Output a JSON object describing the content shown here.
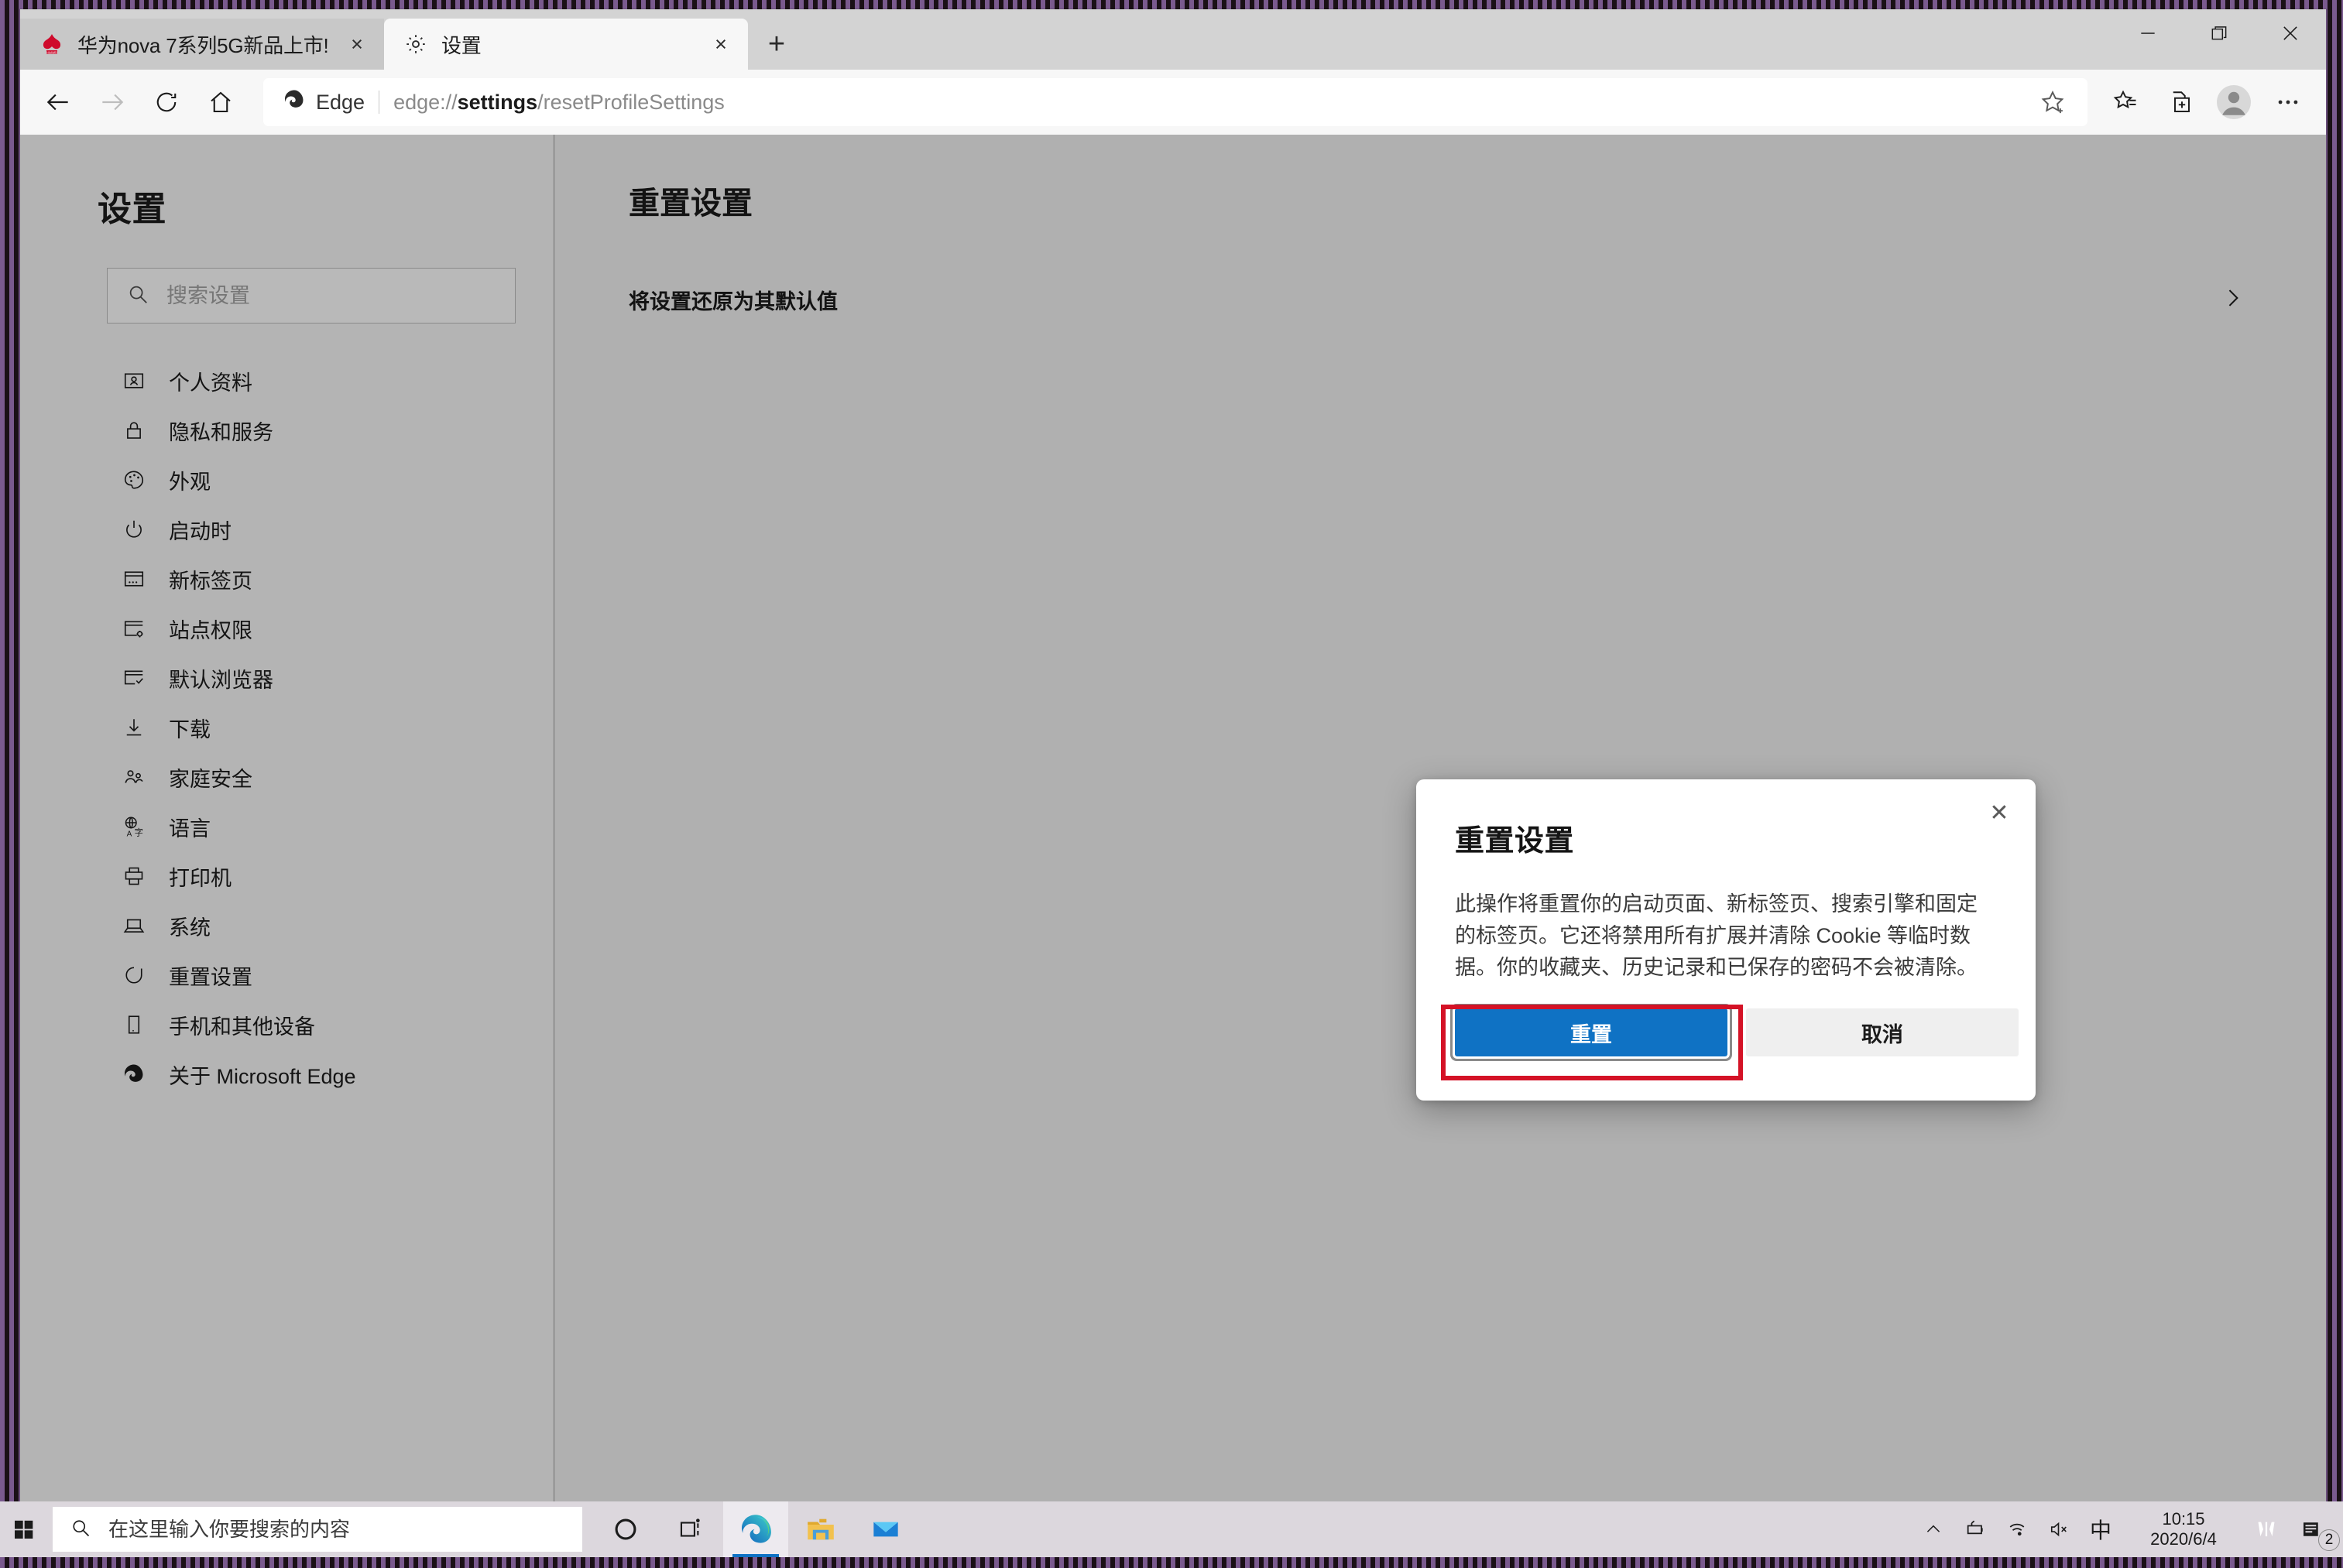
{
  "window": {
    "controls": {
      "minimize": "minimize-icon",
      "maximize": "maximize-icon",
      "close": "close-icon"
    }
  },
  "tabs": [
    {
      "title": "华为nova 7系列5G新品上市!",
      "favicon": "huawei-logo-icon",
      "active": false,
      "close_label": "×"
    },
    {
      "title": "设置",
      "favicon": "gear-icon",
      "active": true,
      "close_label": "×"
    }
  ],
  "new_tab_label": "+",
  "toolbar": {
    "back": "back-arrow-icon",
    "forward": "forward-arrow-icon",
    "refresh": "refresh-icon",
    "home": "home-icon",
    "brand_label": "Edge",
    "url_prefix": "edge://",
    "url_bold": "settings",
    "url_suffix": "/resetProfileSettings",
    "favorite": "star-plus-icon",
    "favorites_list": "favorites-icon",
    "collections": "collections-icon",
    "profile": "profile-avatar-icon",
    "more": "…"
  },
  "sidebar": {
    "title": "设置",
    "search": {
      "placeholder": "搜索设置",
      "value": "",
      "icon": "search-icon"
    },
    "items": [
      {
        "label": "个人资料",
        "icon": "profile-card-icon"
      },
      {
        "label": "隐私和服务",
        "icon": "lock-icon"
      },
      {
        "label": "外观",
        "icon": "palette-icon"
      },
      {
        "label": "启动时",
        "icon": "power-icon"
      },
      {
        "label": "新标签页",
        "icon": "new-tab-page-icon"
      },
      {
        "label": "站点权限",
        "icon": "site-permissions-icon"
      },
      {
        "label": "默认浏览器",
        "icon": "default-browser-icon"
      },
      {
        "label": "下载",
        "icon": "download-icon"
      },
      {
        "label": "家庭安全",
        "icon": "family-safety-icon"
      },
      {
        "label": "语言",
        "icon": "language-icon"
      },
      {
        "label": "打印机",
        "icon": "printer-icon"
      },
      {
        "label": "系统",
        "icon": "system-laptop-icon"
      },
      {
        "label": "重置设置",
        "icon": "reset-circular-arrow-icon"
      },
      {
        "label": "手机和其他设备",
        "icon": "phone-icon"
      },
      {
        "label": "关于 Microsoft Edge",
        "icon": "edge-logo-icon"
      }
    ]
  },
  "main": {
    "title": "重置设置",
    "row": {
      "label": "将设置还原为其默认值",
      "chevron": "chevron-right-icon"
    }
  },
  "dialog": {
    "title": "重置设置",
    "body": "此操作将重置你的启动页面、新标签页、搜索引擎和固定的标签页。它还将禁用所有扩展并清除 Cookie 等临时数据。你的收藏夹、历史记录和已保存的密码不会被清除。",
    "close_icon": "close-icon",
    "close_label": "✕",
    "primary_button": "重置",
    "secondary_button": "取消",
    "accent_color": "#0f72c4",
    "annotation_color": "#d41226"
  },
  "taskbar": {
    "start": "windows-start-icon",
    "search": {
      "placeholder": "在这里输入你要搜索的内容",
      "value": "",
      "icon": "search-icon"
    },
    "pinned": [
      {
        "name": "cortana-icon",
        "running": false
      },
      {
        "name": "task-view-icon",
        "running": false
      },
      {
        "name": "edge-icon",
        "running": true
      },
      {
        "name": "file-explorer-icon",
        "running": false
      },
      {
        "name": "mail-icon",
        "running": false
      }
    ],
    "tray": {
      "show_hidden": "chevron-up-icon",
      "battery": "battery-charging-icon",
      "network": "wifi-icon",
      "volume": "volume-muted-icon",
      "ime": "中",
      "time": "10:15",
      "date": "2020/6/4",
      "extra": "mobile-connect-icon",
      "action_center": "notifications-icon",
      "notification_count": "2"
    }
  }
}
